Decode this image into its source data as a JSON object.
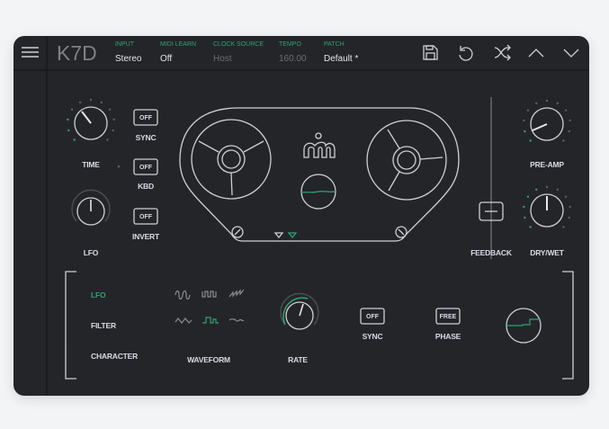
{
  "header": {
    "title": "K7D",
    "fields": [
      {
        "label": "INPUT",
        "value": "Stereo"
      },
      {
        "label": "MIDI LEARN",
        "value": "Off"
      },
      {
        "label": "CLOCK SOURCE",
        "value": "Host"
      },
      {
        "label": "TEMPO",
        "value": "160.00"
      },
      {
        "label": "PATCH",
        "value": "Default *"
      }
    ],
    "icons": [
      "menu-icon",
      "save-icon",
      "undo-icon",
      "shuffle-icon",
      "chevron-up-icon",
      "chevron-down-icon"
    ]
  },
  "left": {
    "time_label": "TIME",
    "lfo_label": "LFO",
    "sync": {
      "value": "OFF",
      "label": "SYNC"
    },
    "kbd": {
      "value": "OFF",
      "label": "KBD"
    },
    "invert": {
      "value": "OFF",
      "label": "INVERT"
    }
  },
  "right": {
    "feedback_label": "FEEDBACK",
    "preamp_label": "PRE-AMP",
    "drywet_label": "DRY/WET"
  },
  "bottom": {
    "tabs": [
      {
        "label": "LFO",
        "active": true
      },
      {
        "label": "FILTER",
        "active": false
      },
      {
        "label": "CHARACTER",
        "active": false
      }
    ],
    "waveform_label": "WAVEFORM",
    "rate_label": "RATE",
    "sync": {
      "value": "OFF",
      "label": "SYNC"
    },
    "phase": {
      "value": "FREE",
      "label": "PHASE"
    }
  },
  "colors": {
    "accent": "#2fa36e",
    "panel": "#242529",
    "stroke": "#cfd0d3"
  }
}
